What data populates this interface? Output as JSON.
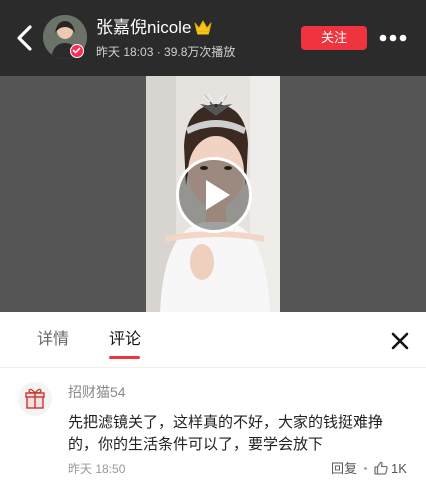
{
  "header": {
    "username": "张嘉倪nicole",
    "meta": "昨天 18:03 · 39.8万次播放",
    "follow_label": "关注"
  },
  "tabs": [
    {
      "label": "详情",
      "active": false
    },
    {
      "label": "评论",
      "active": true
    }
  ],
  "comment": {
    "username": "招财猫54",
    "text": "先把滤镜关了，这样真的不好，大家的钱挺难挣的，你的生活条件可以了，要学会放下",
    "time": "昨天 18:50",
    "reply_label": "回复",
    "like_count": "1K"
  },
  "colors": {
    "accent": "#f0343f",
    "header_bg": "#2b2b2b"
  },
  "icons": [
    "back-arrow-icon",
    "crown-icon",
    "verified-icon",
    "more-icon",
    "play-icon",
    "close-icon",
    "gift-icon",
    "thumbs-up-icon"
  ]
}
